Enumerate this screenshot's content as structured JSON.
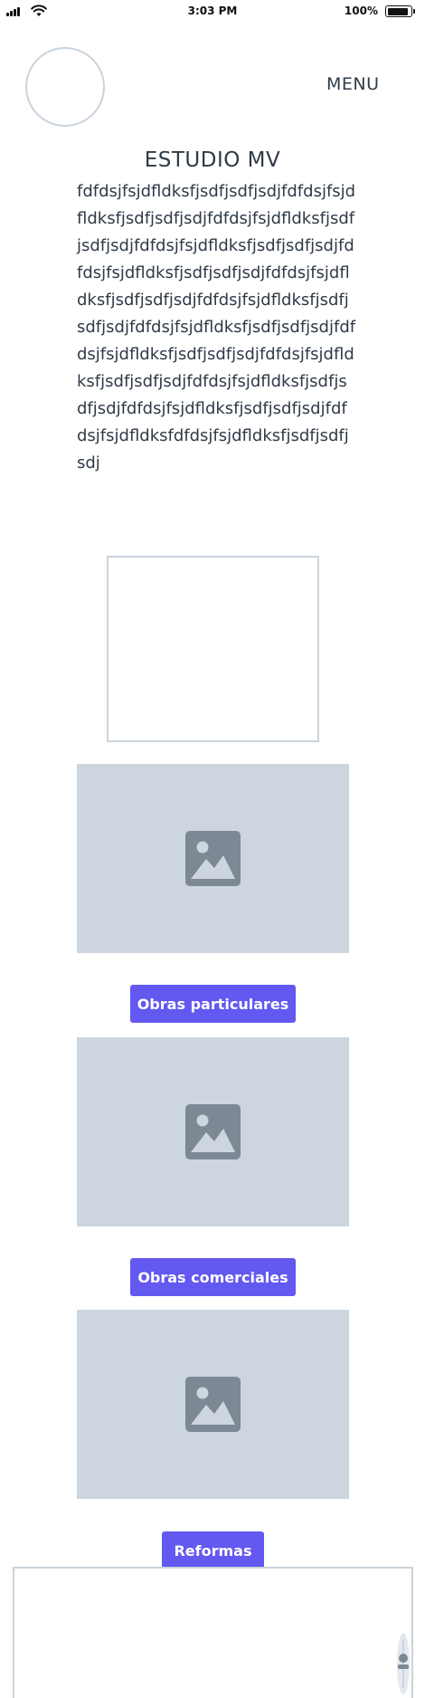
{
  "status_bar": {
    "time": "3:03 PM",
    "battery": "100%"
  },
  "header": {
    "menu_label": "MENU"
  },
  "main": {
    "title": "ESTUDIO MV",
    "body": "fdfdsjfsjdfldksfjsdfjsdfjsdjfdfdsjfsjdfldksfjsdfjsdfjsdjfdfdsjfsjdfldksfjsdfjsdfjsdjfdfdsjfsjdfldksfjsdfjsdfjsdjfdfdsjfsjdfldksfjsdfjsdfjsdjfdfdsjfsjdfldksfjsdfjsdfjsdjfdfdsjfsjdfldksfjsdfjsdfjsdjfdfdsjfsjdfldksfjsdfjsdfjsdjfdfdsjfsjdfldksfjsdfjsdfjsdjfdfdsjfsjdfldksfjsdfjsdfjsdjfdfdsjfsjdfldksfjsdfjsdfjsdjfdfdsjfsjdfldksfjsdfjsdfjsdjfdfdsjfsjdfldksfdfdsjfsjdfldksfjsdfjsdfjsdj"
  },
  "sections": [
    {
      "button_label": "Obras particulares",
      "icon": "image-icon"
    },
    {
      "button_label": "Obras comerciales",
      "icon": "image-icon"
    },
    {
      "button_label": "Reformas",
      "icon": "image-icon"
    }
  ],
  "colors": {
    "accent": "#6358f0",
    "placeholder_bg": "#cdd6df",
    "placeholder_icon": "#7d8895",
    "border": "#c9d3dd",
    "text": "#2f3a48"
  }
}
